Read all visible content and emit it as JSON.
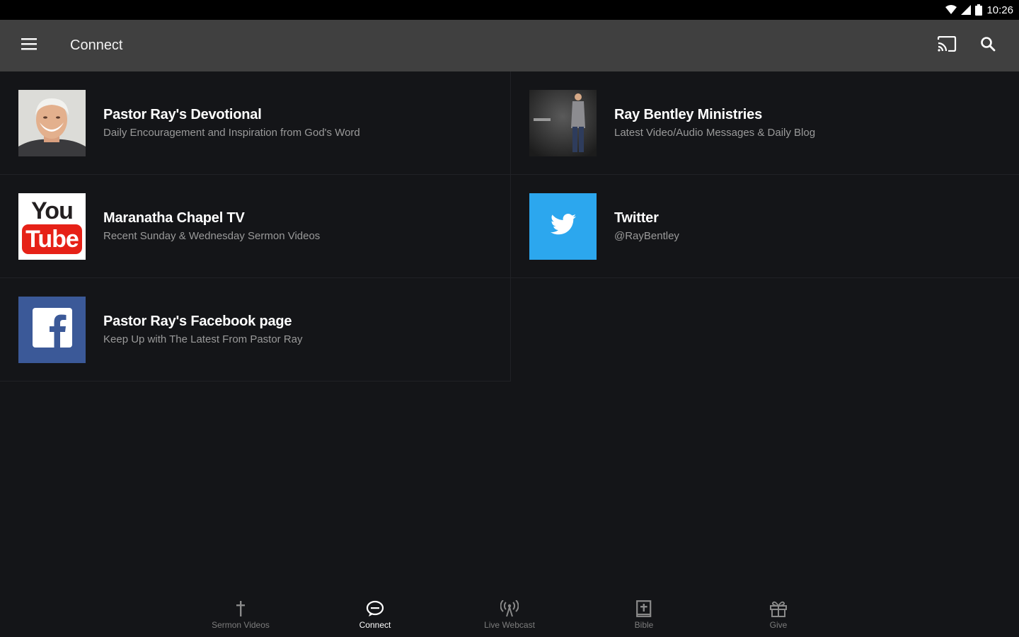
{
  "status_bar": {
    "time": "10:26"
  },
  "app_bar": {
    "title": "Connect"
  },
  "cards": [
    {
      "title": "Pastor Ray's Devotional",
      "subtitle": "Daily Encouragement and Inspiration from God's Word"
    },
    {
      "title": "Ray Bentley Ministries",
      "subtitle": "Latest Video/Audio Messages & Daily Blog"
    },
    {
      "title": "Maranatha Chapel TV",
      "subtitle": "Recent Sunday & Wednesday Sermon Videos",
      "logo_top": "You",
      "logo_bottom": "Tube"
    },
    {
      "title": "Twitter",
      "subtitle": "@RayBentley"
    },
    {
      "title": "Pastor Ray's Facebook page",
      "subtitle": "Keep Up with The Latest From Pastor Ray"
    }
  ],
  "bottom_nav": [
    {
      "label": "Sermon Videos",
      "icon": "cross-icon"
    },
    {
      "label": "Connect",
      "icon": "chat-bubble-icon",
      "active": true
    },
    {
      "label": "Live Webcast",
      "icon": "broadcast-icon"
    },
    {
      "label": "Bible",
      "icon": "bible-icon"
    },
    {
      "label": "Give",
      "icon": "gift-icon"
    }
  ],
  "colors": {
    "background": "#141518",
    "app_bar": "#404040",
    "twitter_blue": "#2ca7ee",
    "facebook_blue": "#3b5998",
    "youtube_red": "#e62117"
  }
}
